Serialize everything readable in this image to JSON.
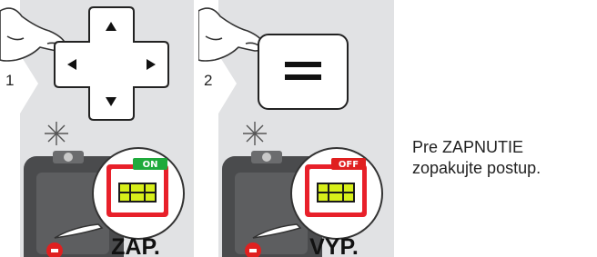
{
  "steps": [
    {
      "number": "1",
      "mode_label": "ZAP.",
      "badge": "ON",
      "badge_color": "#1faa3c",
      "icons": [
        "finger-icon",
        "dpad-icon",
        "device-icon",
        "spirit-level-icon"
      ]
    },
    {
      "number": "2",
      "mode_label": "VYP.",
      "badge": "OFF",
      "badge_color": "#e02020",
      "icons": [
        "finger-icon",
        "equals-button-icon",
        "device-icon",
        "spirit-level-icon"
      ]
    }
  ],
  "instruction": {
    "line1": "Pre ZAPNUTIE",
    "line2": "zopakujte postup."
  },
  "colors": {
    "panel_bg": "#e1e2e4",
    "device_body": "#4a4b4d",
    "level_frame_red": "#e8202a",
    "level_fill": "#d7ef1a"
  }
}
